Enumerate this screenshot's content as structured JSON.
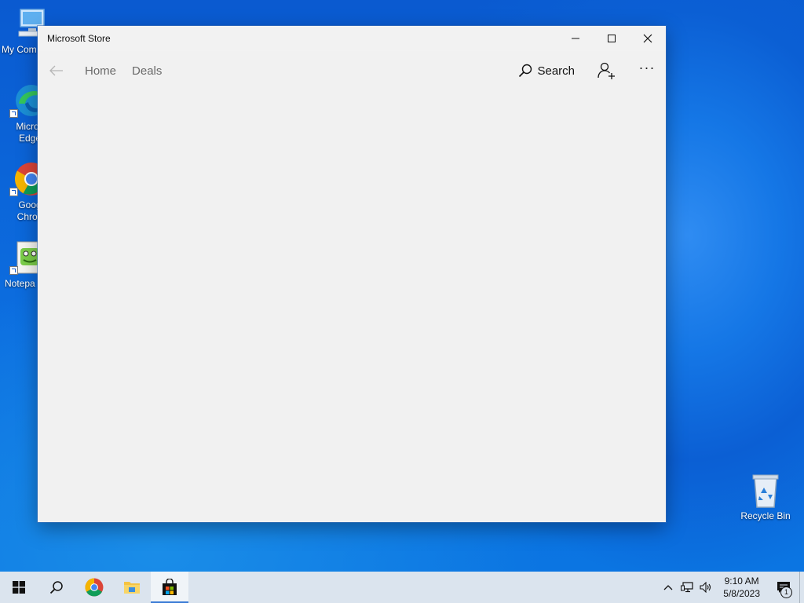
{
  "desktop": {
    "icons": [
      {
        "label": "My Com",
        "icon": "computer-icon"
      },
      {
        "label": "Micros Edge",
        "icon": "edge-icon"
      },
      {
        "label": "Goog Chron",
        "icon": "chrome-icon"
      },
      {
        "label": "Notepa",
        "icon": "notepad-icon"
      },
      {
        "label": "Recycle Bin",
        "icon": "recycle-bin-icon"
      }
    ]
  },
  "window": {
    "title": "Microsoft Store",
    "controls": {
      "minimize": "minimize-icon",
      "maximize": "maximize-icon",
      "close": "close-icon"
    },
    "nav": {
      "back_icon": "back-arrow-icon",
      "links": [
        "Home",
        "Deals"
      ],
      "search_label": "Search",
      "account_icon": "add-account-icon",
      "more_label": "···"
    }
  },
  "taskbar": {
    "buttons": [
      {
        "name": "start",
        "icon": "windows-start-icon"
      },
      {
        "name": "search",
        "icon": "search-icon"
      },
      {
        "name": "chrome",
        "icon": "chrome-icon"
      },
      {
        "name": "file-explorer",
        "icon": "folder-icon"
      },
      {
        "name": "store",
        "icon": "store-bag-icon",
        "active": true
      }
    ],
    "tray": {
      "icons": [
        "chevron-up-icon",
        "network-icon",
        "volume-icon"
      ],
      "time": "9:10 AM",
      "date": "5/8/2023",
      "notification_count": "1"
    }
  },
  "colors": {
    "accent": "#3a7bd5",
    "window_bg": "#f1f1f1",
    "taskbar_bg": "#dbe4ee"
  }
}
